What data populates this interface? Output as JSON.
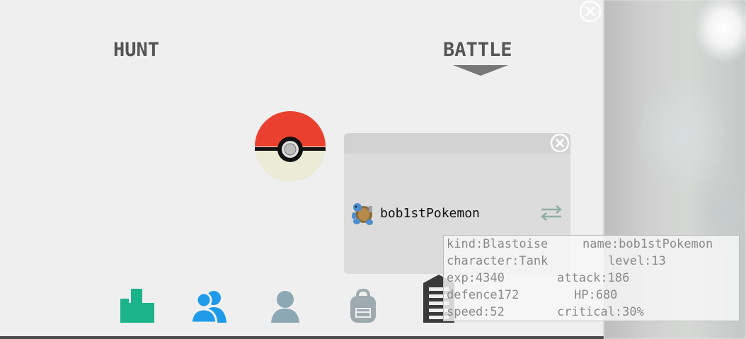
{
  "tabs": {
    "hunt_label": "HUNT",
    "battle_label": "BATTLE",
    "active_tab": "BATTLE"
  },
  "battle_popup": {
    "pokemon_name": "bob1stPokemon"
  },
  "stats": {
    "kind": "kind:Blastoise",
    "name": "name:bob1stPokemon",
    "character": "character:Tank",
    "level": "level:13",
    "exp": "exp:4340",
    "attack": "attack:186",
    "defence": "defence172",
    "hp": "HP:680",
    "speed": "speed:52",
    "critical": "critical:30%"
  },
  "nav": {
    "items": [
      "tetris-blocks-icon",
      "friends-icon",
      "profile-icon",
      "backpack-icon",
      "storage-icon"
    ]
  },
  "colors": {
    "pokeball_red": "#ea4030",
    "pokeball_white": "#ecebd8",
    "nav_green": "#1bb38a",
    "nav_blue": "#1e9be8",
    "nav_gray_blue": "#8ba8b4",
    "nav_gray": "#9daab0",
    "nav_dark": "#3a3a3a"
  }
}
